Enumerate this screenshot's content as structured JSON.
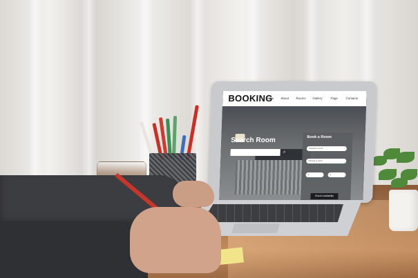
{
  "website": {
    "brand": "BOOKING",
    "nav_links": [
      "Home",
      "About",
      "Rooms",
      "Gallery",
      "Page",
      "Contacts"
    ],
    "hero": {
      "search_title": "Search Room",
      "search_icon": "search-icon"
    },
    "booking_panel": {
      "title": "Book a Room",
      "fields": [
        {
          "label": "",
          "value": "Choose a room"
        },
        {
          "label": "",
          "value": "Choose a room"
        }
      ],
      "small_fields": [
        {
          "label": "",
          "value": "1"
        },
        {
          "label": "",
          "value": "1"
        }
      ],
      "button_label": "Check Availability"
    }
  },
  "colors": {
    "nav_bg": "#ffffff",
    "panel_bg": "#5a5e62",
    "button_bg": "#1b1d20",
    "pen_red": "#c8352b",
    "plant_green": "#4e8a3a"
  }
}
